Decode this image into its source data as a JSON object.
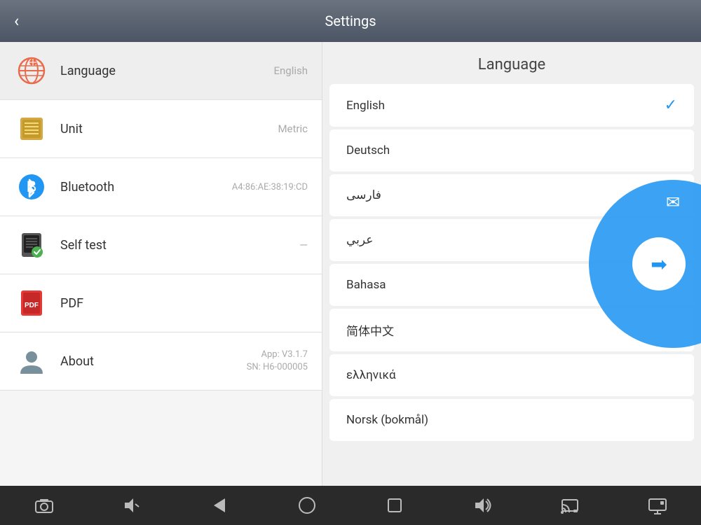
{
  "header": {
    "title": "Settings",
    "back_label": "‹"
  },
  "sidebar": {
    "items": [
      {
        "id": "language",
        "label": "Language",
        "value": "English",
        "icon": "globe"
      },
      {
        "id": "unit",
        "label": "Unit",
        "value": "Metric",
        "icon": "grid"
      },
      {
        "id": "bluetooth",
        "label": "Bluetooth",
        "value": "A4:86:AE:38:19:CD",
        "icon": "bluetooth"
      },
      {
        "id": "selftest",
        "label": "Self test",
        "value": "—",
        "icon": "selftest"
      },
      {
        "id": "pdf",
        "label": "PDF",
        "value": "",
        "icon": "pdf"
      },
      {
        "id": "about",
        "label": "About",
        "value": "App: V3.1.7\nSN: H6-000005",
        "icon": "person"
      }
    ]
  },
  "language_panel": {
    "title": "Language",
    "languages": [
      {
        "id": "english",
        "label": "English",
        "selected": true
      },
      {
        "id": "deutsch",
        "label": "Deutsch",
        "selected": false
      },
      {
        "id": "farsi",
        "label": "فارسی",
        "selected": false
      },
      {
        "id": "arabic",
        "label": "عربي",
        "selected": false
      },
      {
        "id": "bahasa",
        "label": "Bahasa",
        "selected": false
      },
      {
        "id": "chinese",
        "label": "简体中文",
        "selected": false
      },
      {
        "id": "greek",
        "label": "ελληνικά",
        "selected": false
      },
      {
        "id": "norwegian",
        "label": "Norsk (bokmål)",
        "selected": false
      }
    ]
  },
  "bottom_nav": {
    "buttons": [
      "camera",
      "volume-down",
      "back",
      "home",
      "square",
      "volume-up",
      "cast",
      "screen"
    ]
  }
}
